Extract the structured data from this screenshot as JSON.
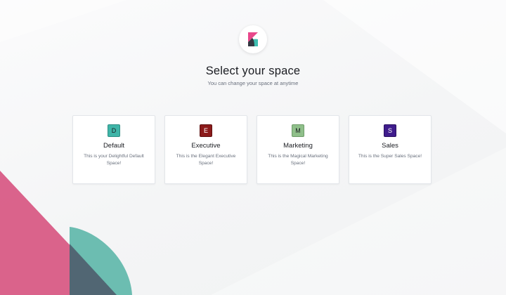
{
  "page": {
    "title": "Select your space",
    "subtitle": "You can change your space at anytime"
  },
  "logo": {
    "icon": "kibana-logo-icon"
  },
  "spaces": [
    {
      "initial": "D",
      "name": "Default",
      "description": "This is your Delightful Default Space!",
      "color": "#3fb5a8",
      "text_color": "#1a1c21"
    },
    {
      "initial": "E",
      "name": "Executive",
      "description": "This is the Elegant Executive Space!",
      "color": "#8b1a1a",
      "text_color": "#ffffff"
    },
    {
      "initial": "M",
      "name": "Marketing",
      "description": "This is the Magical Marketing Space!",
      "color": "#8fbf8a",
      "text_color": "#1a1c21"
    },
    {
      "initial": "S",
      "name": "Sales",
      "description": "This is the Super Sales Space!",
      "color": "#3f1c8c",
      "text_color": "#ffffff"
    }
  ],
  "colors": {
    "logo_pink": "#e8488b",
    "logo_teal": "#3ebeb0",
    "logo_dark": "#343741",
    "decor_pink": "#d64e7c",
    "decor_teal": "#54b3a5",
    "decor_slate": "#5b6171"
  }
}
